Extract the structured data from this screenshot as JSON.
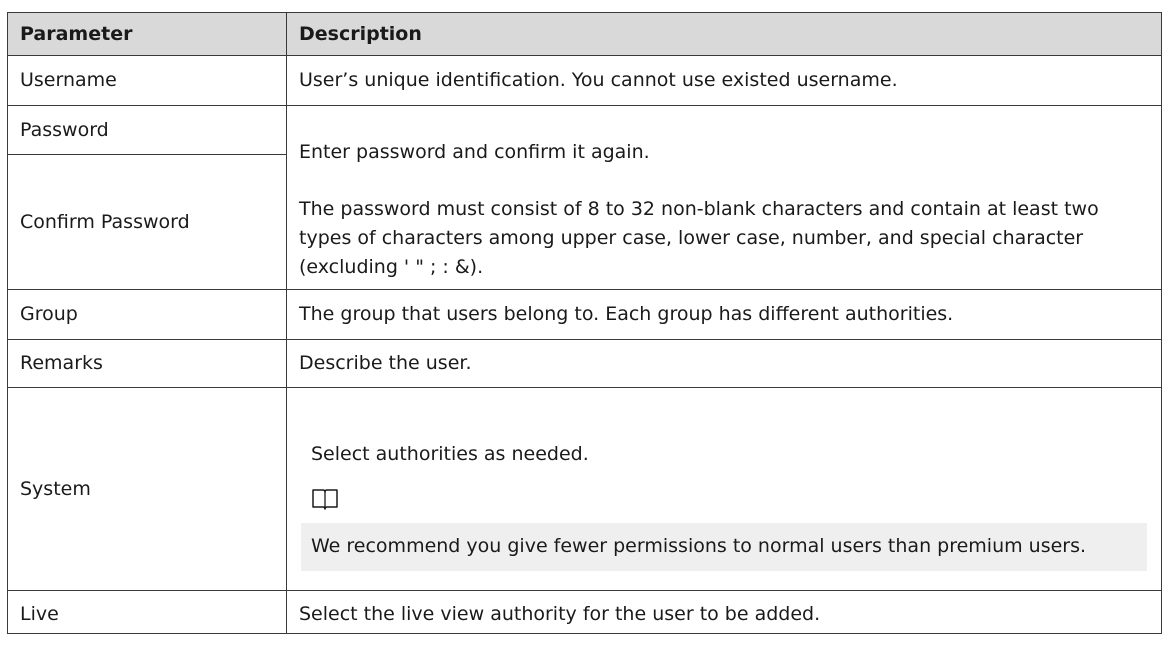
{
  "table": {
    "headers": {
      "parameter": "Parameter",
      "description": "Description"
    },
    "rows": {
      "username": {
        "param": "Username",
        "desc": "User’s unique identification. You cannot use existed username."
      },
      "password": {
        "param": "Password",
        "desc": "Enter password and confirm it again."
      },
      "confirm_password": {
        "param": "Confirm Password",
        "desc": "The password must consist of 8 to 32 non-blank characters and contain at least two types of characters among upper case, lower case, number, and special character (excluding ' \" ; : &)."
      },
      "group": {
        "param": "Group",
        "desc": "The group that users belong to. Each group has different authorities."
      },
      "remarks": {
        "param": "Remarks",
        "desc": "Describe the user."
      },
      "system": {
        "param": "System",
        "desc": "Select authorities as needed.",
        "note_icon": "book-icon",
        "note": "We recommend you give fewer permissions to normal users than premium users."
      },
      "live": {
        "param": "Live",
        "desc": "Select the live view authority for the user to be added."
      }
    }
  },
  "colors": {
    "header_bg": "#d9d9d9",
    "note_bg": "#efefef",
    "border": "#3a3a3a"
  }
}
